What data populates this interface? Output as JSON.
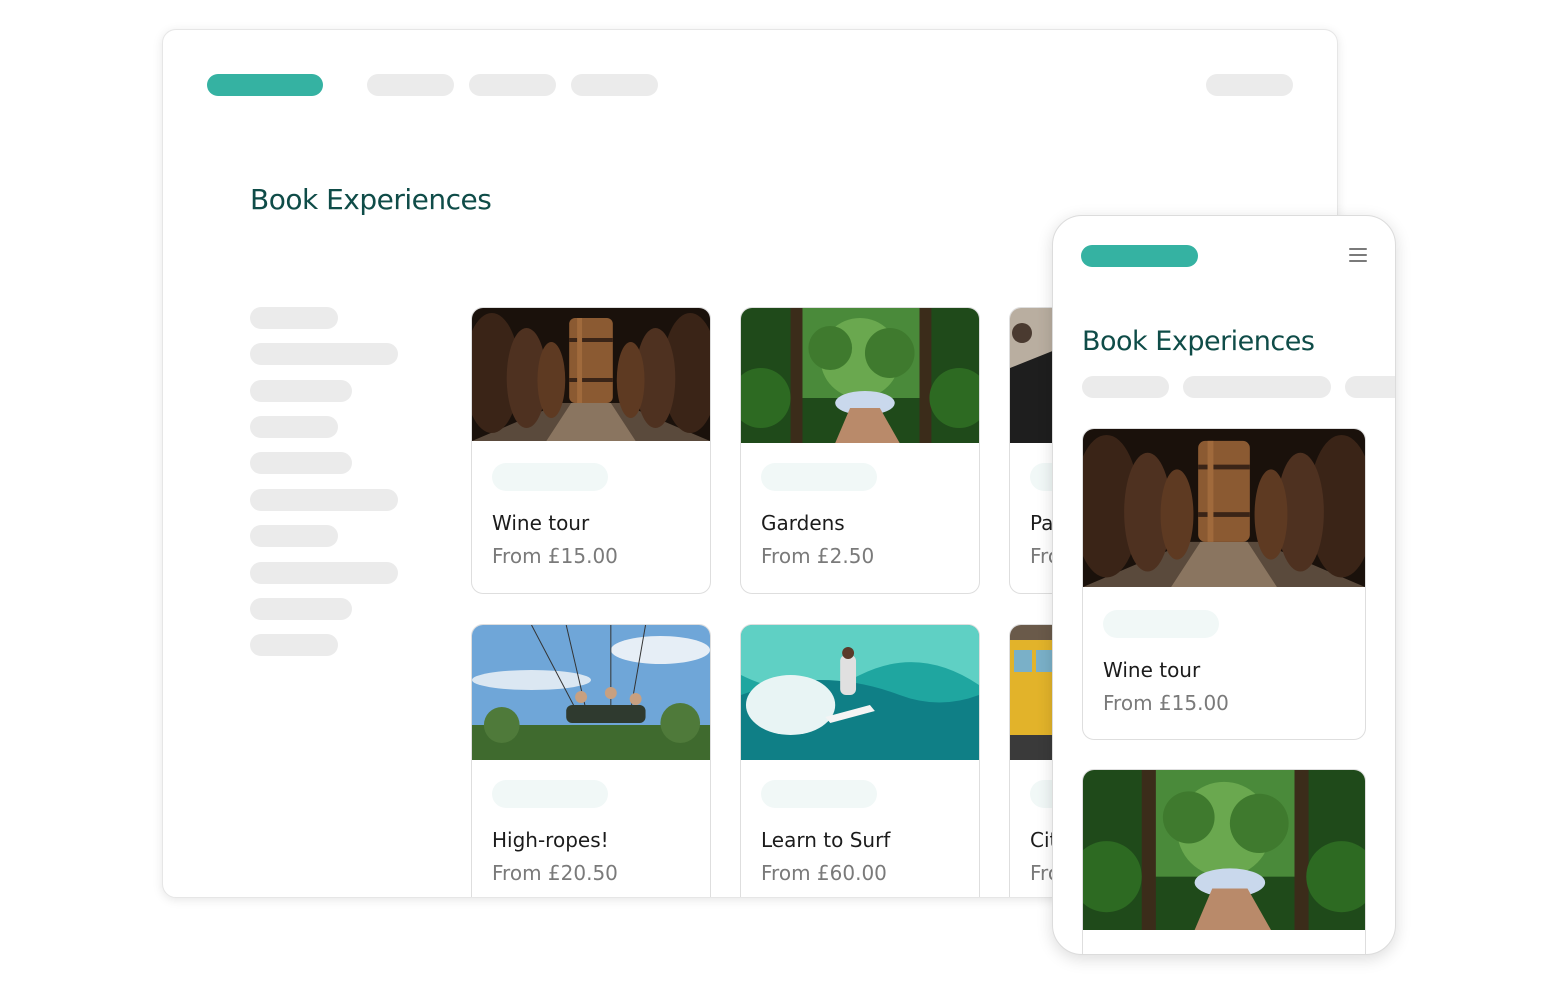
{
  "desktop": {
    "page_title": "Book Experiences",
    "cards": [
      {
        "title": "Wine tour",
        "price": "From £15.00",
        "image": "wine-cellar-image"
      },
      {
        "title": "Gardens",
        "price": "From £2.50",
        "image": "garden-path-image"
      },
      {
        "title": "Pa",
        "price": "Fro",
        "image": "partial-image"
      },
      {
        "title": "High-ropes!",
        "price": "From £20.50",
        "image": "high-ropes-swing-image"
      },
      {
        "title": "Learn to Surf",
        "price": "From £60.00",
        "image": "surf-wave-image"
      },
      {
        "title": "Cit",
        "price": "Fro",
        "image": "city-tram-image"
      }
    ]
  },
  "mobile": {
    "page_title": "Book Experiences",
    "menu_icon": "hamburger-menu-icon",
    "cards": [
      {
        "title": "Wine tour",
        "price": "From £15.00",
        "image": "wine-cellar-image"
      },
      {
        "title": "",
        "price": "",
        "image": "garden-path-image"
      }
    ]
  },
  "colors": {
    "accent": "#35b2a2",
    "heading": "#0f4c48",
    "placeholder": "#ebebeb",
    "tag_tint": "#f1f8f7"
  }
}
